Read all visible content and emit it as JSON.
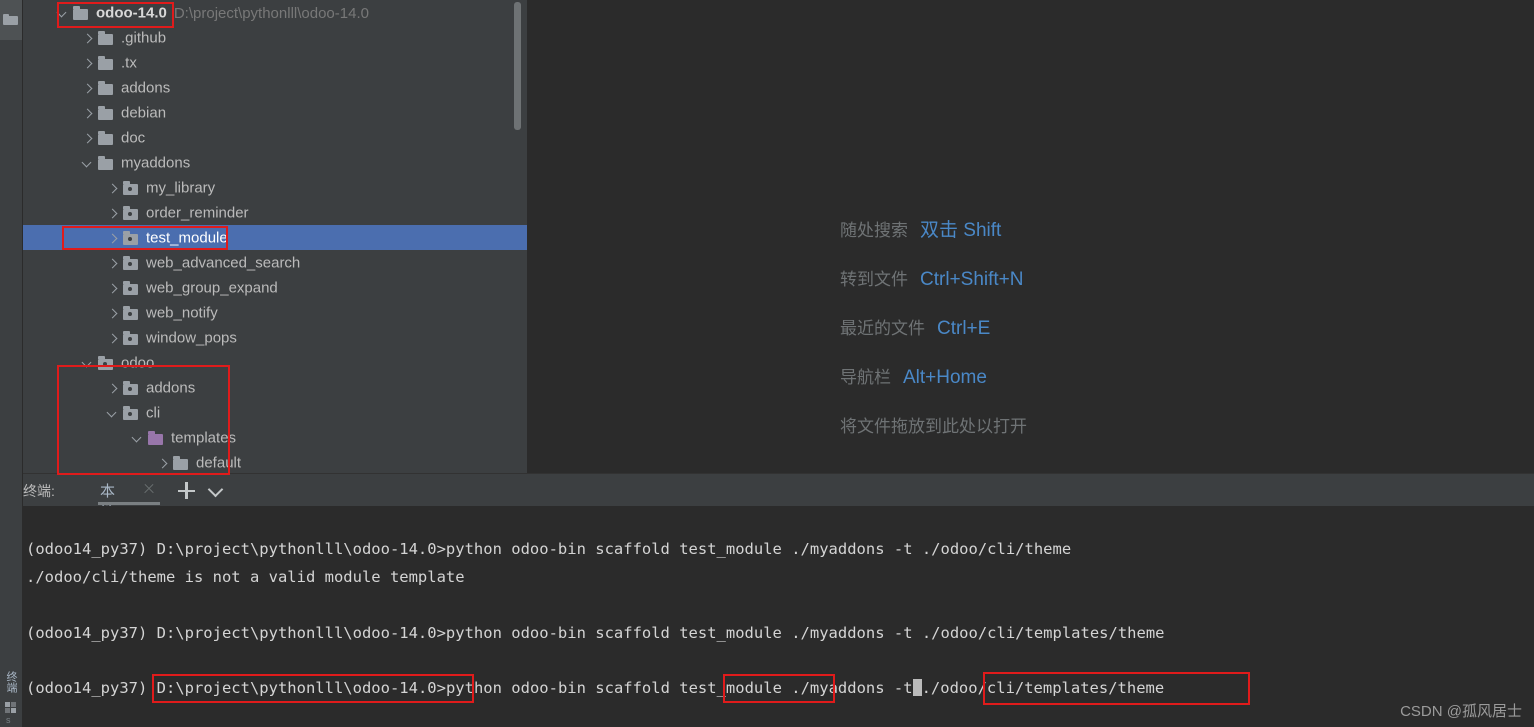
{
  "toolstrip": {
    "folder_icon": "folder-icon",
    "terminal_label": "终端",
    "grid_icon": "grid-icon",
    "status_letter": "s"
  },
  "project_tree": {
    "scrollbar": "vertical-scrollbar",
    "rows": [
      {
        "depth": 0,
        "arrow": "open",
        "icon": "folder",
        "label": "odoo-14.0",
        "bold": true,
        "path": "D:\\project\\pythonlll\\odoo-14.0"
      },
      {
        "depth": 1,
        "arrow": "closed",
        "icon": "folder",
        "label": ".github"
      },
      {
        "depth": 1,
        "arrow": "closed",
        "icon": "folder",
        "label": ".tx"
      },
      {
        "depth": 1,
        "arrow": "closed",
        "icon": "folder",
        "label": "addons"
      },
      {
        "depth": 1,
        "arrow": "closed",
        "icon": "folder",
        "label": "debian"
      },
      {
        "depth": 1,
        "arrow": "closed",
        "icon": "folder",
        "label": "doc"
      },
      {
        "depth": 1,
        "arrow": "open",
        "icon": "folder",
        "label": "myaddons"
      },
      {
        "depth": 2,
        "arrow": "closed",
        "icon": "module",
        "label": "my_library"
      },
      {
        "depth": 2,
        "arrow": "closed",
        "icon": "module",
        "label": "order_reminder"
      },
      {
        "depth": 2,
        "arrow": "closed",
        "icon": "module",
        "label": "test_module",
        "selected": true
      },
      {
        "depth": 2,
        "arrow": "closed",
        "icon": "module",
        "label": "web_advanced_search"
      },
      {
        "depth": 2,
        "arrow": "closed",
        "icon": "module",
        "label": "web_group_expand"
      },
      {
        "depth": 2,
        "arrow": "closed",
        "icon": "module",
        "label": "web_notify"
      },
      {
        "depth": 2,
        "arrow": "closed",
        "icon": "module",
        "label": "window_pops"
      },
      {
        "depth": 1,
        "arrow": "open",
        "icon": "module",
        "label": "odoo"
      },
      {
        "depth": 2,
        "arrow": "closed",
        "icon": "module",
        "label": "addons"
      },
      {
        "depth": 2,
        "arrow": "open",
        "icon": "module",
        "label": "cli"
      },
      {
        "depth": 3,
        "arrow": "open",
        "icon": "purple",
        "label": "templates"
      },
      {
        "depth": 4,
        "arrow": "closed",
        "icon": "folder",
        "label": "default"
      }
    ]
  },
  "editor_hints": [
    {
      "label": "随处搜索",
      "key": "双击 Shift"
    },
    {
      "label": "转到文件",
      "key": "Ctrl+Shift+N"
    },
    {
      "label": "最近的文件",
      "key": "Ctrl+E"
    },
    {
      "label": "导航栏",
      "key": "Alt+Home"
    },
    {
      "label": "将文件拖放到此处以打开",
      "key": ""
    }
  ],
  "terminal": {
    "caption": "终端:",
    "tab_label": "本地",
    "close_icon": "close-icon",
    "add_icon": "plus-icon",
    "menu_icon": "chevron-down-icon",
    "lines": [
      "(odoo14_py37) D:\\project\\pythonlll\\odoo-14.0>python odoo-bin scaffold test_module ./myaddons -t ./odoo/cli/theme",
      "./odoo/cli/theme is not a valid module template",
      "(odoo14_py37) D:\\project\\pythonlll\\odoo-14.0>python odoo-bin scaffold test_module ./myaddons -t ./odoo/cli/templates/theme"
    ],
    "prompt_line": {
      "prefix": "(odoo14_py37) ",
      "cwd": "D:\\project\\pythonlll\\odoo-14.0",
      "arrow": ">",
      "command": "python odoo-bin scaffold ",
      "module": "test_module",
      "args": " ./myaddons -t",
      "template": "./odoo/cli/templates/theme"
    }
  },
  "annotations": {
    "color": "#e01b1b",
    "boxes": [
      "project-root-highlight",
      "test-module-highlight",
      "odoo-cli-templates-highlight",
      "cwd-highlight",
      "module-name-highlight",
      "template-path-highlight"
    ]
  },
  "watermark": "CSDN @孤风居士"
}
